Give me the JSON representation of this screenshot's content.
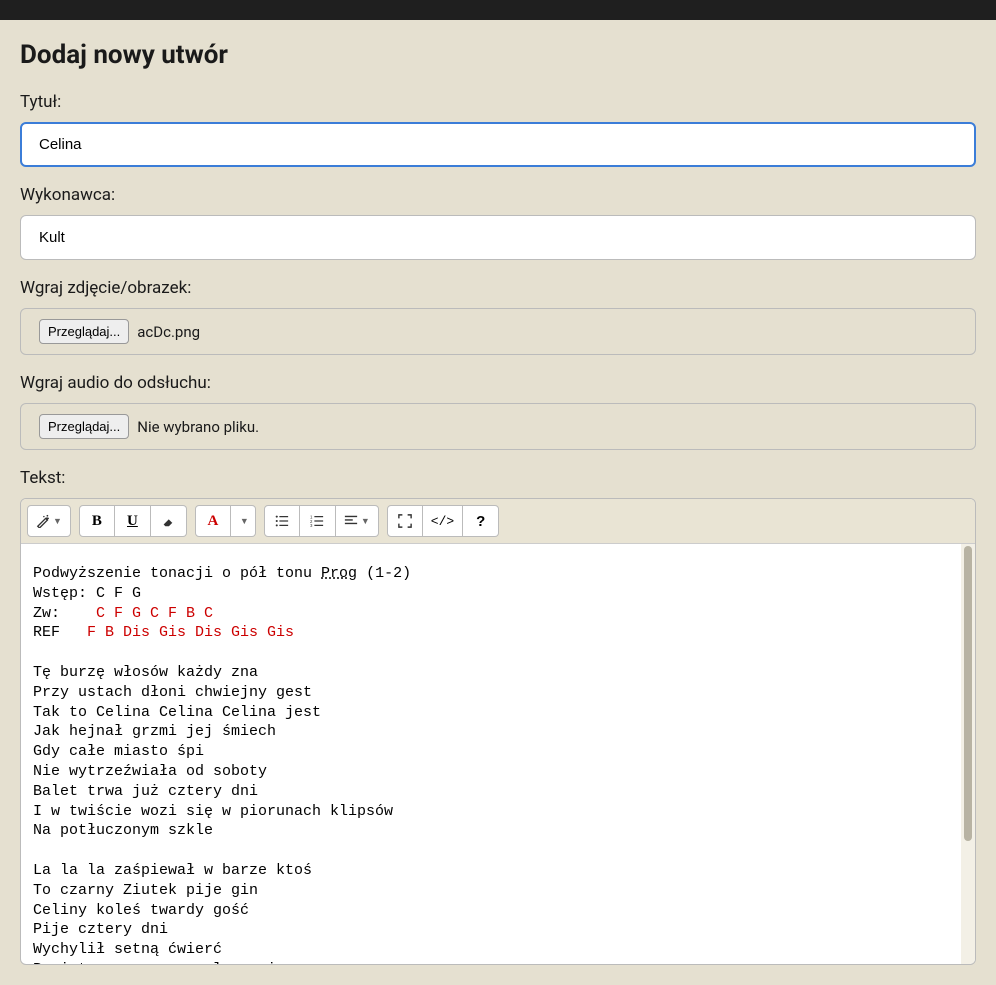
{
  "page": {
    "heading": "Dodaj nowy utwór"
  },
  "fields": {
    "title": {
      "label": "Tytuł:",
      "value": "Celina"
    },
    "artist": {
      "label": "Wykonawca:",
      "value": "Kult"
    },
    "image": {
      "label": "Wgraj zdjęcie/obrazek:",
      "browse": "Przeglądaj...",
      "filename": "acDc.png"
    },
    "audio": {
      "label": "Wgraj audio do odsłuchu:",
      "browse": "Przeglądaj...",
      "filename": "Nie wybrano pliku."
    },
    "text": {
      "label": "Tekst:"
    }
  },
  "editor": {
    "line1_pre": "Podwyższenie tonacji o pół tonu ",
    "line1_prog": "Prog",
    "line1_post": " (1-2)",
    "line2": "Wstęp: C F G",
    "line3_pre": "Zw:    ",
    "line3_chords": "C F G C F B C",
    "line4_pre": "REF   ",
    "line4_chords": "F B Dis Gis Dis Gis Gis",
    "verse1": "Tę burzę włosów każdy zna\nPrzy ustach dłoni chwiejny gest\nTak to Celina Celina Celina jest\nJak hejnał grzmi jej śmiech\nGdy całe miasto śpi\nNie wytrzeźwiała od soboty\nBalet trwa już cztery dni\nI w twiście wozi się w piorunach klipsów\nNa potłuczonym szkle",
    "verse2": "La la la zaśpiewał w barze ktoś\nTo czarny Ziutek pije gin\nCeliny koleś twardy gość\nPije cztery dni\nWychylił setną ćwierć\nPowietrze zaraz wyszło z niego"
  },
  "toolbar": {
    "magic": "magic",
    "bold": "B",
    "underline": "U",
    "eraser": "eraser",
    "color": "A",
    "ul": "ul",
    "ol": "ol",
    "align": "align",
    "fullscreen": "fullscreen",
    "code": "</>",
    "help": "?"
  }
}
